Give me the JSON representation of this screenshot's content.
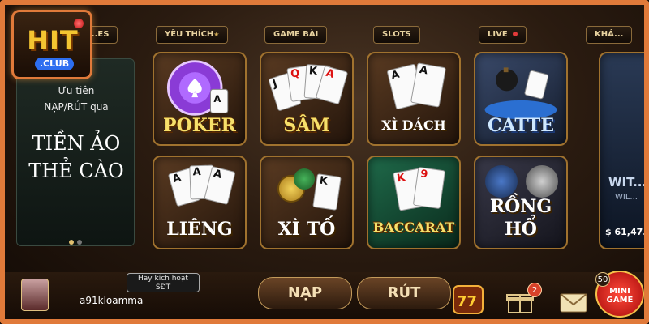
{
  "nav": {
    "tabs": [
      {
        "label": "...ES"
      },
      {
        "label": "YÊU THÍCH",
        "star": "★"
      },
      {
        "label": "GAME BÀI"
      },
      {
        "label": "SLOTS"
      },
      {
        "label": "LIVE"
      },
      {
        "label": "KHÁ..."
      }
    ]
  },
  "logo": {
    "main": "HIT",
    "sub": ".CLUB"
  },
  "promo": {
    "line1": "Ưu tiên",
    "line2": "NẠP/RÚT qua",
    "line3": "TIỀN ẢO",
    "line4": "THẺ CÀO"
  },
  "games": [
    {
      "name": "POKER"
    },
    {
      "name": "SÂM"
    },
    {
      "name": "XÌ DÁCH"
    },
    {
      "name": "CATTE"
    },
    {
      "name": "LIÊNG"
    },
    {
      "name": "XÌ TỐ"
    },
    {
      "name": "BACCARAT"
    },
    {
      "name": "RỒNG"
    },
    {
      "name": "HỔ"
    }
  ],
  "partial_tile": {
    "name": "WIT...",
    "sub": "WIL...",
    "jackpot": "$ 61,47..."
  },
  "user": {
    "activate_label_1": "Hãy kích hoạt",
    "activate_label_2": "SĐT",
    "username": "a91kloamma"
  },
  "actions": {
    "deposit_label": "NẠP",
    "withdraw_label": "RÚT",
    "gift_badge": "2",
    "mini_badge": "50",
    "mini_label_1": "MINI",
    "mini_label_2": "GAME"
  },
  "colors": {
    "frame": "#e07a3a",
    "accent_gold": "#f7e06a",
    "badge_red": "#d8422a"
  }
}
